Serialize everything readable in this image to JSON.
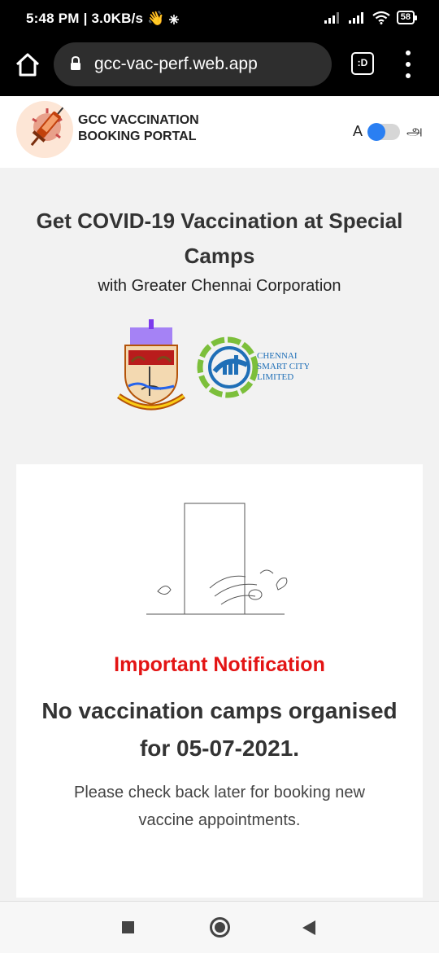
{
  "status_bar": {
    "time": "5:48 PM | 3.0KB/s",
    "wave_emoji": "👋",
    "battery": "58",
    "icons": [
      "wave-icon",
      "sparkle-icon",
      "signal-icon",
      "signal-icon",
      "wifi-icon",
      "battery-icon"
    ]
  },
  "browser": {
    "url": "gcc-vac-perf.web.app",
    "tab_label": ":D",
    "icons": [
      "home-icon",
      "lock-icon",
      "tabs-icon",
      "more-vert-icon"
    ]
  },
  "header": {
    "brand_line1": "GCC VACCINATION",
    "brand_line2": "BOOKING PORTAL",
    "lang_en": "A",
    "lang_ta": "அ",
    "toggle_on": true
  },
  "hero": {
    "title": "Get COVID-19 Vaccination at Special Camps",
    "subtitle": "with Greater Chennai Corporation",
    "logo_csc_line1": "CHENNAI",
    "logo_csc_line2": "SMART CITY",
    "logo_csc_line3": "LIMITED"
  },
  "notice": {
    "label": "Important Notification",
    "headline": "No vaccination camps organised for 05-07-2021.",
    "description": "Please check back later for booking new vaccine appointments."
  },
  "colors": {
    "accent_blue": "#2a7ff2",
    "alert_red": "#e31414",
    "csc_green": "#7cbf3b",
    "csc_blue": "#1f6fb7"
  }
}
